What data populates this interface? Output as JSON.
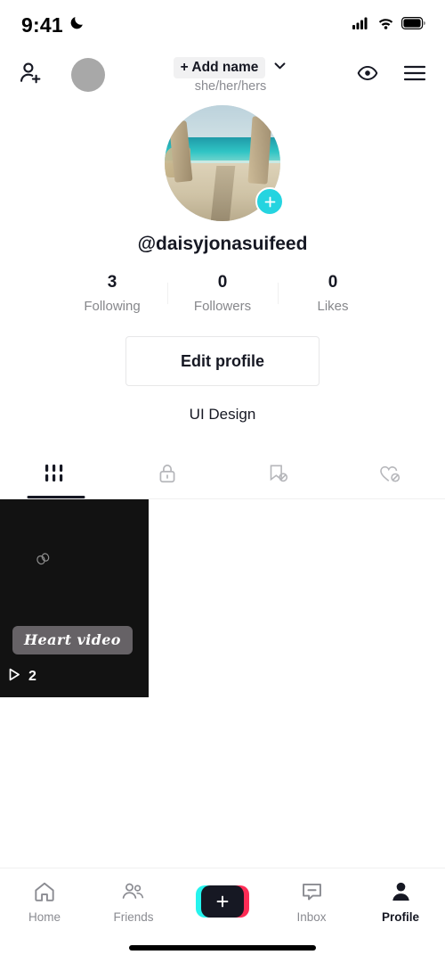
{
  "status_bar": {
    "time": "9:41",
    "dnd_icon": "crescent-moon-icon",
    "signal_icon": "cellular-signal-icon",
    "wifi_icon": "wifi-icon",
    "battery_icon": "battery-full-icon"
  },
  "top_nav": {
    "add_friend_icon": "add-friend-icon",
    "account_switch_avatar": "account-avatar-placeholder",
    "add_name_label": "+ Add name",
    "chevron_icon": "chevron-down-icon",
    "pronouns": "she/her/hers",
    "views_icon": "eye-icon",
    "menu_icon": "hamburger-menu-icon"
  },
  "profile": {
    "avatar_alt": "beach-path-avatar",
    "avatar_plus_icon": "plus-icon",
    "handle": "@daisyjonasuifeed",
    "bio": "UI Design",
    "edit_button_label": "Edit profile",
    "stats": [
      {
        "value": "3",
        "label": "Following"
      },
      {
        "value": "0",
        "label": "Followers"
      },
      {
        "value": "0",
        "label": "Likes"
      }
    ]
  },
  "content_tabs": [
    {
      "icon": "grid-icon",
      "active": true
    },
    {
      "icon": "lock-icon",
      "active": false
    },
    {
      "icon": "bookmark-hidden-icon",
      "active": false
    },
    {
      "icon": "heart-hidden-icon",
      "active": false
    }
  ],
  "videos": [
    {
      "caption": "Heart video",
      "play_count": "2",
      "play_icon": "play-triangle-icon",
      "overlay_icon": "rings-sticker-icon"
    }
  ],
  "bottom_nav": [
    {
      "label": "Home",
      "icon": "home-icon",
      "active": false
    },
    {
      "label": "Friends",
      "icon": "friends-icon",
      "active": false
    },
    {
      "label": "",
      "icon": "create-plus-icon",
      "active": false
    },
    {
      "label": "Inbox",
      "icon": "inbox-icon",
      "active": false
    },
    {
      "label": "Profile",
      "icon": "profile-person-icon",
      "active": true
    }
  ],
  "colors": {
    "accent_cyan": "#25f4ee",
    "accent_pink": "#fe2c55",
    "avatar_badge": "#25d4e0",
    "text_primary": "#161823",
    "text_muted": "#8a8b91"
  }
}
